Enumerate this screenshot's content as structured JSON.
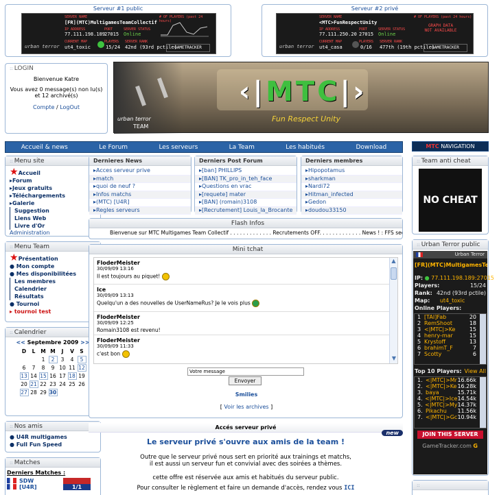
{
  "servers": [
    {
      "title": "Serveur #1 public",
      "name": "[FR](MTC)MultigamesTeamCollectif",
      "ip": "77.111.198.189",
      "port": "27015",
      "status": "Online",
      "map": "ut4_toxic",
      "players": "15/24",
      "rank": "42nd (93rd pctile)"
    },
    {
      "title": "Serveur #2 privé",
      "name": "<MTC>FunRespectUnity",
      "ip": "77.111.250.20",
      "port": "27015",
      "status": "Online",
      "map": "ut4_casa",
      "players": "0/16",
      "rank": "477th (19th pctile)",
      "graph_note": "GRAPH DATA NOT AVAILABLE"
    }
  ],
  "banner_labels": {
    "server_name": "SERVER NAME",
    "ip": "IP ADDRESS",
    "port": "PORT",
    "status": "SERVER STATUS",
    "map": "CURRENT MAP",
    "players": "PLAYERS",
    "rank": "SERVER RANK",
    "graph": "# OF PLAYERS (past 24 hours)",
    "brand": "GAMETRACKER",
    "site": "www.gametracker.com",
    "game": "urban terror"
  },
  "login": {
    "header": "LOGIN",
    "welcome": "Bienvenue Katre",
    "messages": "Vous avez 0 message(s) non lu(s) et 12 archivé(s)",
    "compte": "Compte",
    "logout": "LogOut",
    "sep": " / "
  },
  "hero": {
    "title": "MTC",
    "subtitle": "Fun Respect Unity",
    "game": "urban terror",
    "team": "TEAM"
  },
  "nav": [
    "Accueil & news",
    "Le Forum",
    "Les serveurs",
    "La Team",
    "Les habitués",
    "Download"
  ],
  "nav_logo": {
    "brand": "MTC",
    "label": "NAVIGATION"
  },
  "menu_site": {
    "header": "Menu site",
    "items": [
      "Accueil",
      "Forum",
      "Jeux gratuits",
      "Téléchargements",
      "Galerie",
      "Suggestion",
      "Liens Web",
      "Livre d'Or",
      "Administration"
    ]
  },
  "menu_team": {
    "header": "Menu Team",
    "items": [
      "Présentation",
      "Mon compte",
      "Mes disponibilitées",
      "Les membres",
      "Calendrier",
      "Résultats",
      "Tournoi",
      "tournoi test"
    ]
  },
  "calendar": {
    "header": "Calendrier",
    "month": "Septembre 2009",
    "prev": "<<",
    "next": ">>",
    "days": [
      "D",
      "L",
      "M",
      "M",
      "J",
      "V",
      "S"
    ],
    "weeks": [
      [
        "",
        "",
        "1",
        "2",
        "3",
        "4",
        "5"
      ],
      [
        "6",
        "7",
        "8",
        "9",
        "10",
        "11",
        "12"
      ],
      [
        "13",
        "14",
        "15",
        "16",
        "17",
        "18",
        "19"
      ],
      [
        "20",
        "21",
        "22",
        "23",
        "24",
        "25",
        "26"
      ],
      [
        "27",
        "28",
        "29",
        "30",
        "",
        "",
        ""
      ]
    ]
  },
  "amis": {
    "header": "Nos amis",
    "items": [
      "U4R multigames",
      "Full Fun Speed"
    ]
  },
  "matches": {
    "header": "Matches",
    "title": "Derniers Matches :",
    "rows": [
      {
        "team": "SDW",
        "score": ""
      },
      {
        "team": "[U4R]",
        "score": "1/1"
      }
    ]
  },
  "news": {
    "header": "Dernieres News",
    "items": [
      "Acces serveur prive",
      "match",
      "quoi de neuf ?",
      "Infos matchs",
      "(MTC) [U4R]",
      "Regles serveurs"
    ]
  },
  "posts": {
    "header": "Derniers Post Forum",
    "items": [
      "[ban] PHILLIPS",
      "[BAN] TK_pro_in_teh_face",
      "Questions en vrac",
      "[requete] mater",
      "[BAN] (romain)3108",
      "[Recrutement] Louis_la_Brocante"
    ]
  },
  "members": {
    "header": "Derniers membres",
    "items": [
      "Hipopotamus",
      "sharkman",
      "Nardi72",
      "Hitman_infected",
      "Gedon",
      "doudou33150"
    ]
  },
  "flash": {
    "header": "Flash Infos",
    "text": "Bienvenue sur MTC Multigames Team Collectif . . . . . . . . . . . . . Recrutements OFF. . . . . . . . . . . . . News ! : FFS section tr"
  },
  "tchat": {
    "header": "Mini tchat",
    "messages": [
      {
        "name": "FloderMeister",
        "date": "30/09/09 13:16",
        "msg": "Il est toujours au piquet!"
      },
      {
        "name": "Ice",
        "date": "30/09/09 13:13",
        "msg": "Quelqu'un a des nouvelles de UserNameRus? Je le vois plus"
      },
      {
        "name": "FloderMeister",
        "date": "30/09/09 12:25",
        "msg": "Romain3108 est revenu!"
      },
      {
        "name": "FloderMeister",
        "date": "30/09/09 11:33",
        "msg": "c'est bon"
      }
    ],
    "input_value": "Votre message",
    "send": "Envoyer",
    "smilies": "Smilies",
    "archives": "Voir les archives"
  },
  "article": {
    "header": "Accés serveur privé",
    "badge": "new",
    "title": "Le serveur privé s'ouvre aux amis de la team !",
    "p1": "Outre que le serveur privé nous sert en priorité aux trainings et matchs,",
    "p2": "il est aussi un serveur fun et convivial avec des soirées a thèmes.",
    "p3": "cette offre est réservée aux amis et habitués du serveur public.",
    "p4": "Pour consulter le règlement et faire un demande d'accès, rendez vous",
    "p4_link": "ICI"
  },
  "anticheat": {
    "header": "Team anti cheat",
    "logo_text": "NO CHEAT"
  },
  "ut_public": {
    "header": "Urban Terror public",
    "game": "Urban Terror",
    "name": "[FR](MTC)MultigamesTe",
    "ip_label": "IP:",
    "ip": "77.111.198.189:27015",
    "players_label": "Players:",
    "players": "15/24",
    "rank_label": "Rank:",
    "rank": "42nd (93rd pctile)",
    "map_label": "Map:",
    "map": "ut4_toxic",
    "online_label": "Online Players:",
    "online": [
      {
        "n": "1",
        "name": "[TAI]Fab",
        "s": "20"
      },
      {
        "n": "2",
        "name": "RemShoot",
        "s": "18"
      },
      {
        "n": "3",
        "name": "<|MTC|>Ke",
        "s": "15"
      },
      {
        "n": "4",
        "name": "henry-mar",
        "s": "15"
      },
      {
        "n": "5",
        "name": "Krystoff",
        "s": "13"
      },
      {
        "n": "6",
        "name": "brahimT_F",
        "s": "7"
      },
      {
        "n": "7",
        "name": "Scotty",
        "s": "6"
      }
    ],
    "top_label": "Top 10 Players:",
    "view_all": "View All",
    "top": [
      {
        "n": "1.",
        "name": "<|MTC|>Mr",
        "t": "16.66k"
      },
      {
        "n": "2.",
        "name": "<|MTC|>Ke",
        "t": "16.28k"
      },
      {
        "n": "3.",
        "name": "baya",
        "t": "15.71k"
      },
      {
        "n": "4.",
        "name": "<|MTC|>Ice",
        "t": "14.54k"
      },
      {
        "n": "5.",
        "name": "<|MTC|>My",
        "t": "14.37k"
      },
      {
        "n": "6.",
        "name": "Pikachu",
        "t": "11.56k"
      },
      {
        "n": "7.",
        "name": "<|MTC|>Gc",
        "t": "10.94k"
      }
    ],
    "join": "JOIN THIS SERVER",
    "brand": "GameTracker.com"
  },
  "colors": {
    "accent": "#2b63a6",
    "border": "#9cb6d6",
    "gt_bg": "#1b1b1b",
    "gt_text": "#ffb400"
  }
}
